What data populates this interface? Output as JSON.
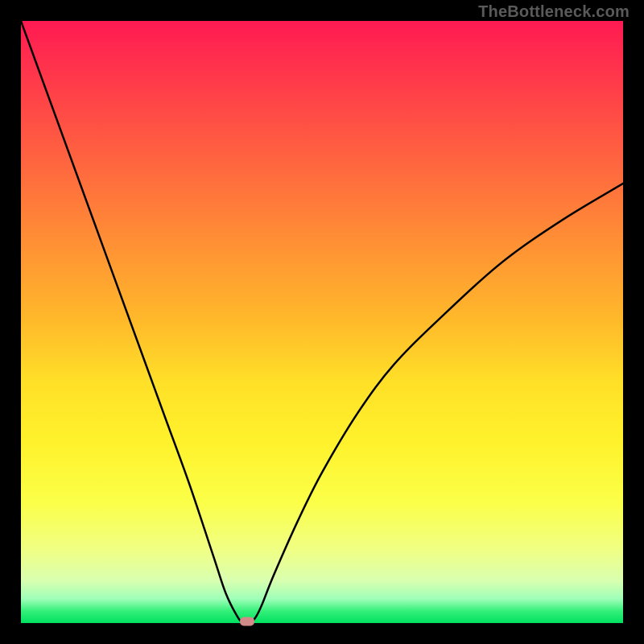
{
  "watermark": "TheBottleneck.com",
  "colors": {
    "background": "#000000",
    "curve_stroke": "#000000",
    "marker_fill": "#d18a88",
    "gradient_top": "#ff1a52",
    "gradient_bottom": "#00e060"
  },
  "chart_data": {
    "type": "line",
    "title": "",
    "xlabel": "",
    "ylabel": "",
    "xlim": [
      0,
      100
    ],
    "ylim": [
      0,
      100
    ],
    "x": [
      0,
      4,
      8,
      12,
      16,
      20,
      24,
      28,
      32,
      34,
      36,
      37,
      38,
      39,
      40,
      42,
      46,
      50,
      56,
      62,
      70,
      80,
      90,
      100
    ],
    "series": [
      {
        "name": "bottleneck-curve",
        "values": [
          100,
          89,
          78,
          67,
          56,
          45,
          34,
          23,
          11,
          5,
          1,
          0,
          0,
          1,
          3,
          8,
          17,
          25,
          35,
          43,
          51,
          60,
          67,
          73
        ]
      }
    ],
    "marker": {
      "x": 37.5,
      "y": 0
    },
    "gradient_meaning": "red=high bottleneck, green=no bottleneck"
  }
}
